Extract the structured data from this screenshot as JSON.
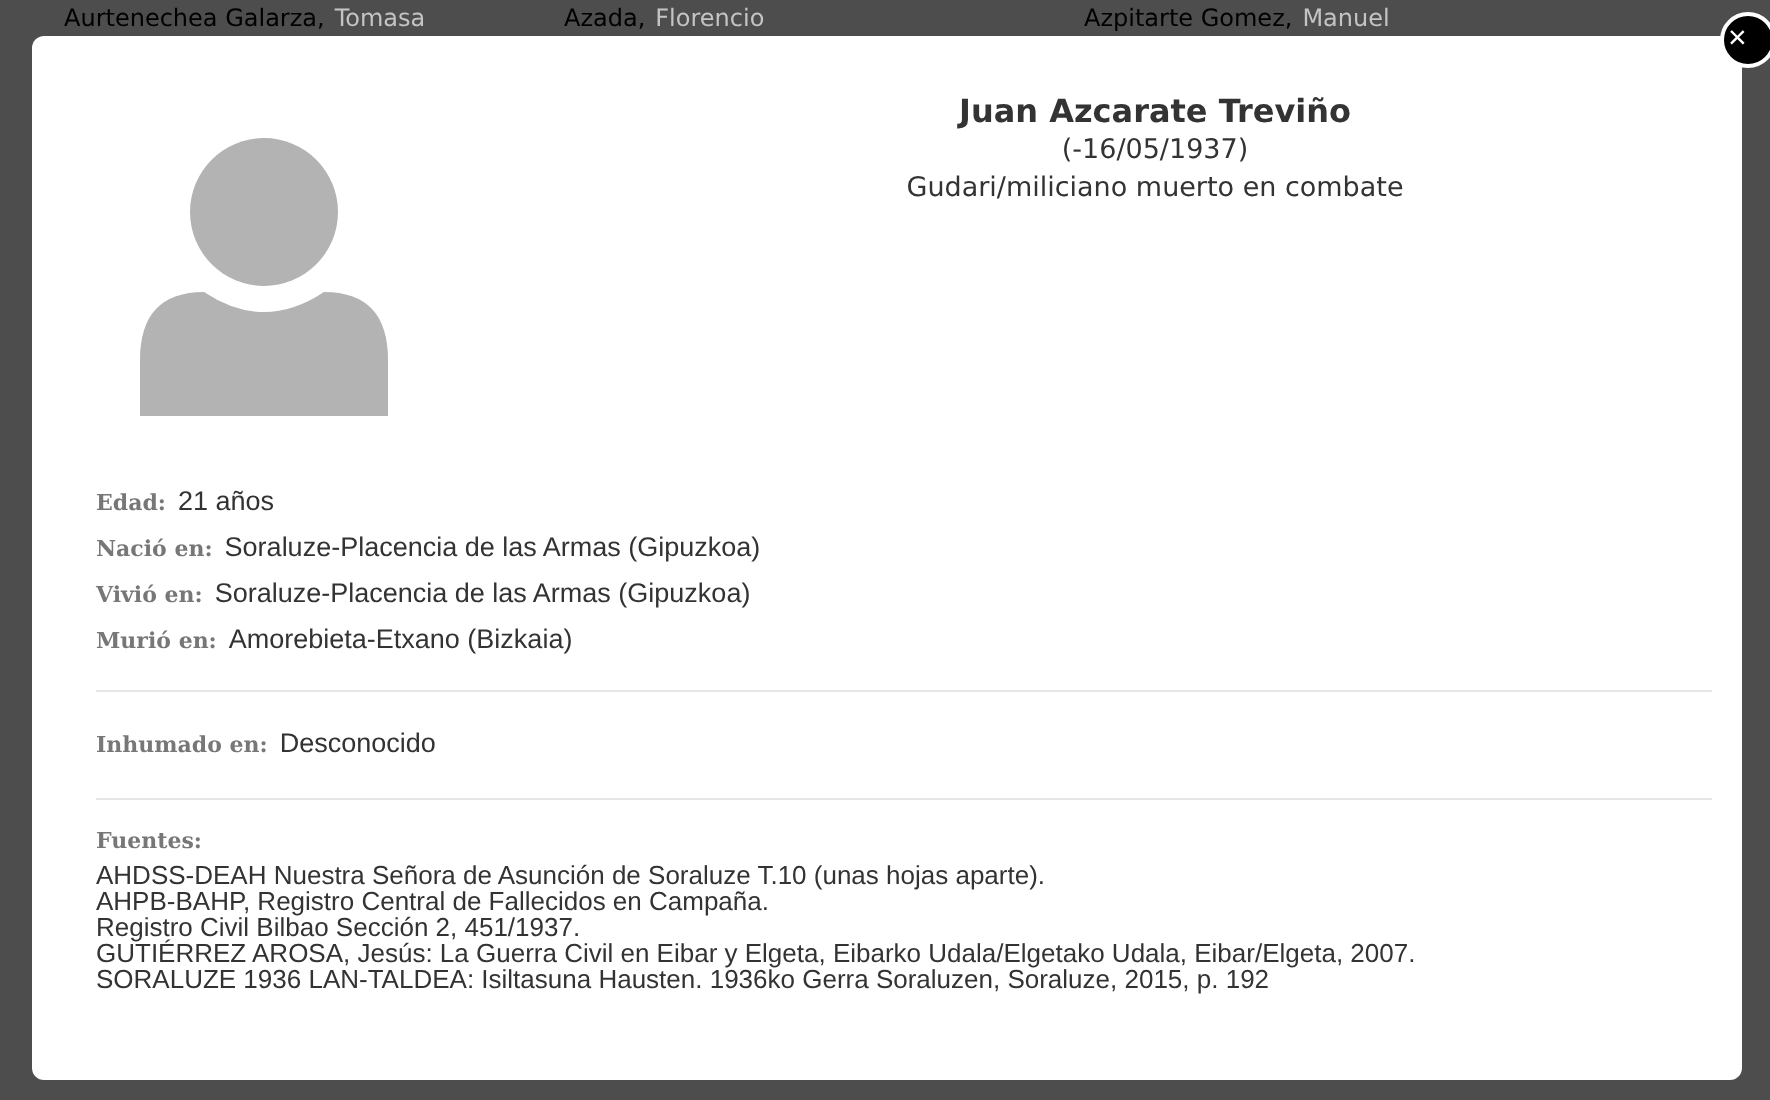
{
  "background_list": {
    "top_row": [
      {
        "surname": "Aurtenechea Galarza,",
        "given": "Tomasa"
      },
      {
        "surname": "Azada,",
        "given": "Florencio"
      },
      {
        "surname": "Azpitarte Gomez,",
        "given": "Manuel"
      }
    ]
  },
  "modal": {
    "close": "×",
    "name": "Juan Azcarate Treviño",
    "dates": "(-16/05/1937)",
    "category": "Gudari/miliciano muerto en combate",
    "facts": [
      {
        "label": "Edad:",
        "value": "21 años"
      },
      {
        "label": "Nació en:",
        "value": "Soraluze-Placencia de las Armas (Gipuzkoa)"
      },
      {
        "label": "Vivió en:",
        "value": "Soraluze-Placencia de las Armas (Gipuzkoa)"
      },
      {
        "label": "Murió en:",
        "value": "Amorebieta-Etxano (Bizkaia)"
      }
    ],
    "burial": {
      "label": "Inhumado en:",
      "value": "Desconocido"
    },
    "sources": {
      "label": "Fuentes:",
      "lines": [
        "AHDSS-DEAH Nuestra Señora de Asunción de Soraluze T.10 (unas hojas aparte).",
        "AHPB-BAHP, Registro Central de Fallecidos en Campaña.",
        "Registro Civil Bilbao Sección 2, 451/1937.",
        "GUTIÉRREZ AROSA, Jesús: La Guerra Civil en Eibar y Elgeta, Eibarko Udala/Elgetako Udala, Eibar/Elgeta, 2007.",
        "SORALUZE 1936 LAN-TALDEA: Isiltasuna Hausten. 1936ko Gerra Soraluzen, Soraluze, 2015, p. 192"
      ]
    }
  }
}
